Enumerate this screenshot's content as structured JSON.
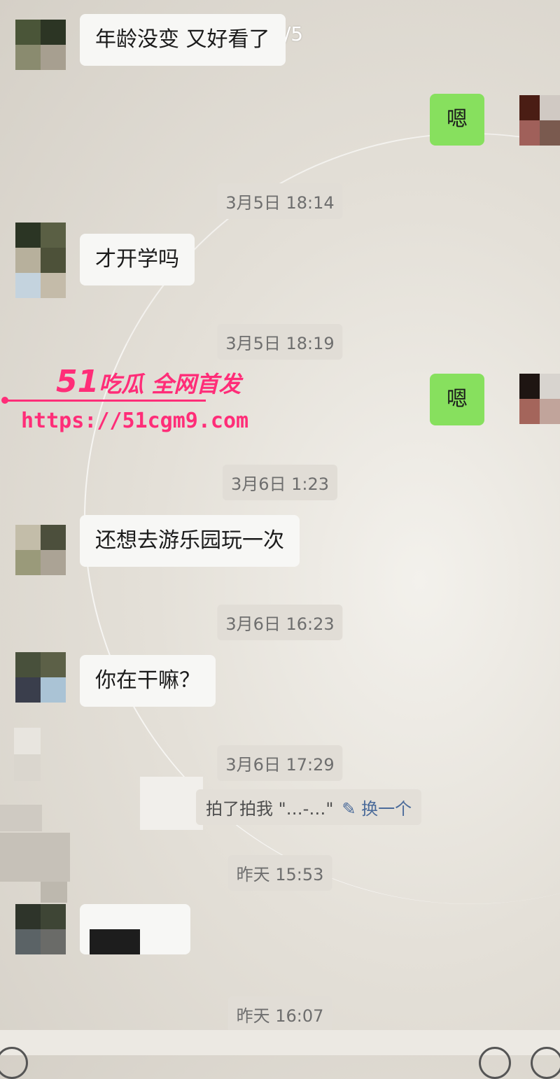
{
  "image_counter": "2/5",
  "colors": {
    "accent_green": "#87e05e",
    "watermark_pink": "#ff2d78"
  },
  "messages": [
    {
      "side": "left",
      "text": "年龄没变 又好看了"
    },
    {
      "side": "right",
      "text": "嗯"
    },
    {
      "side": "time",
      "text": "3月5日 18:14"
    },
    {
      "side": "left",
      "text": "才开学吗"
    },
    {
      "side": "time",
      "text": "3月5日 18:19"
    },
    {
      "side": "right",
      "text": "嗯"
    },
    {
      "side": "time",
      "text": "3月6日 1:23"
    },
    {
      "side": "left",
      "text": "还想去游乐园玩一次"
    },
    {
      "side": "time",
      "text": "3月6日 16:23"
    },
    {
      "side": "left",
      "text": "你在干嘛？"
    },
    {
      "side": "time",
      "text": "3月6日 17:29"
    },
    {
      "side": "system",
      "text": "拍了拍我 \"…-…\"",
      "action": "换一个"
    },
    {
      "side": "time",
      "text": "昨天 15:53"
    },
    {
      "side": "time",
      "text": "昨天 16:07"
    }
  ],
  "watermark": {
    "brand_num": "51",
    "brand_text": "吃瓜 全网首发",
    "url": "https://51cgm9.com"
  }
}
